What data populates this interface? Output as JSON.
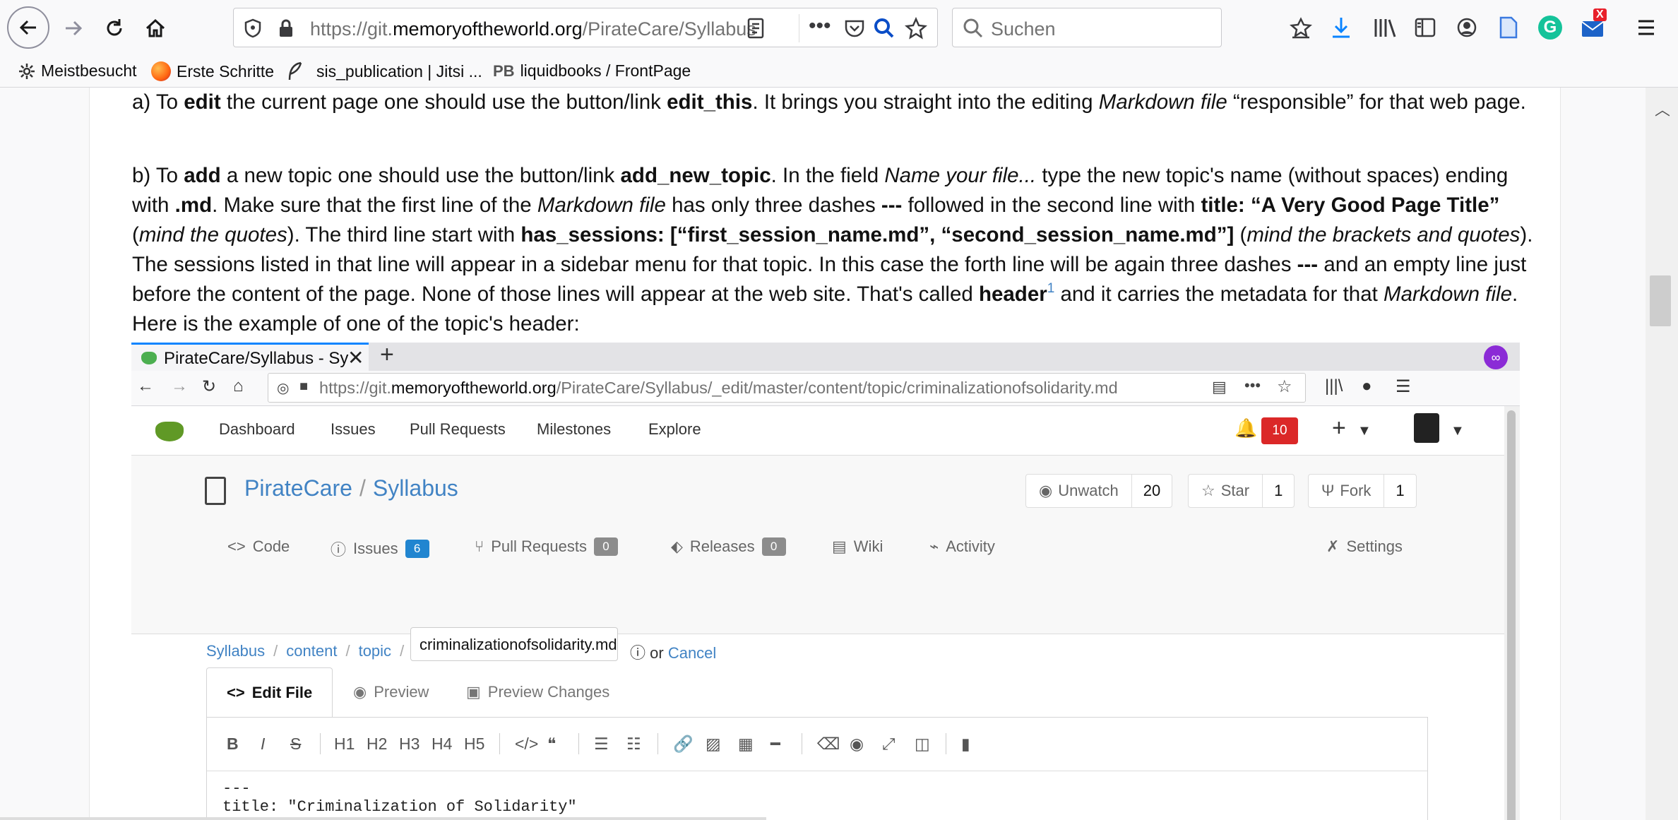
{
  "browser": {
    "url_prefix": "https://git.",
    "url_domain": "memoryoftheworld.org",
    "url_path": "/PirateCare/Syllabus",
    "search_placeholder": "Suchen",
    "mail_badge": "X",
    "bookmarks": [
      {
        "label": "Meistbesucht"
      },
      {
        "label": "Erste Schritte"
      },
      {
        "label": "sis_publication | Jitsi ..."
      },
      {
        "label": "liquidbooks / FrontPage",
        "prefix": "PB"
      }
    ]
  },
  "content": {
    "para_a": {
      "p1": "a) To ",
      "b1": "edit",
      "p2": " the current page one should use the button/link ",
      "b2": "edit_this",
      "p3": ". It brings you straight into the editing ",
      "i1": "Markdown file",
      "p4": " “responsible” for that web page."
    },
    "para_b": {
      "t1": "b) To ",
      "b1": "add",
      "t2": " a new topic one should use the button/link ",
      "b2": "add_new_topic",
      "t3": ". In the field ",
      "i1": "Name your file...",
      "t4": " type the new topic's name (without spaces) ending with ",
      "b3": ".md",
      "t5": ". Make sure that the first line of the ",
      "i2": "Markdown file",
      "t6": " has only three dashes ",
      "b4": "---",
      "t7": " followed in the second line with ",
      "b5": "title: “A Very Good Page Title”",
      "t8": " (",
      "i3": "mind the quotes",
      "t9": "). The third line start with ",
      "b6": "has_sessions: [“first_session_name.md”, “second_session_name.md”]",
      "t10": " (",
      "i4": "mind the brackets and quotes",
      "t11": "). The sessions listed in that line will appear in a sidebar menu for that topic. In this case the forth line will be again three dashes ",
      "b7": "---",
      "t12": " and an empty line just before the content of the page. None of those lines will appear at the web site. That's called ",
      "b8": "header",
      "sup": "1",
      "t13": " and it carries the metadata for that ",
      "i5": "Markdown file",
      "t14": ". Here is the example of one of the topic's header:"
    }
  },
  "screenshot": {
    "tab_title": "PirateCare/Syllabus - Sy",
    "url_prefix": "https://git.",
    "url_domain": "memoryoftheworld.org",
    "url_path": "/PirateCare/Syllabus/_edit/master/content/topic/criminalizationofsolidarity.md",
    "nav": [
      "Dashboard",
      "Issues",
      "Pull Requests",
      "Milestones",
      "Explore"
    ],
    "notifications": "10",
    "repo_owner": "PirateCare",
    "repo_name": "Syllabus",
    "unwatch_label": "Unwatch",
    "unwatch_count": "20",
    "star_label": "Star",
    "star_count": "1",
    "fork_label": "Fork",
    "fork_count": "1",
    "tabs": {
      "code": "Code",
      "issues": "Issues",
      "issues_count": "6",
      "pulls": "Pull Requests",
      "pulls_count": "0",
      "releases": "Releases",
      "releases_count": "0",
      "wiki": "Wiki",
      "activity": "Activity",
      "settings": "Settings"
    },
    "breadcrumb": [
      "Syllabus",
      "content",
      "topic"
    ],
    "filename": "criminalizationofsolidarity.md",
    "or_label": "or",
    "cancel_label": "Cancel",
    "edit_tabs": [
      "Edit File",
      "Preview",
      "Preview Changes"
    ],
    "toolbar": [
      "B",
      "I",
      "S",
      "H1",
      "H2",
      "H3",
      "H4",
      "H5"
    ],
    "code_lines": [
      "---",
      "title: \"Criminalization of Solidarity\""
    ]
  },
  "colors": {
    "link": "#4183c4",
    "gitea_green": "#609926",
    "badge_red": "#db2828",
    "badge_blue": "#2185d0",
    "tab_accent": "#0a84ff"
  }
}
